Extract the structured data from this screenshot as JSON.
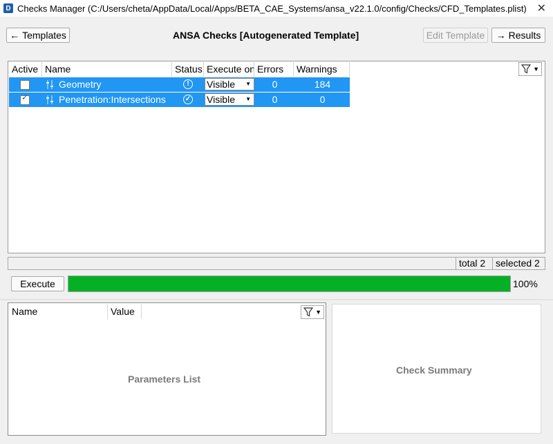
{
  "window": {
    "icon_letter": "D",
    "title": "Checks Manager (C:/Users/cheta/AppData/Local/Apps/BETA_CAE_Systems/ansa_v22.1.0/config/Checks/CFD_Templates.plist)",
    "close_glyph": "✕"
  },
  "toolbar": {
    "templates_label": "Templates",
    "templates_arrow": "←",
    "header_title": "ANSA Checks [Autogenerated Template]",
    "edit_template_label": "Edit Template",
    "results_label": "Results",
    "results_arrow": "→"
  },
  "checks_table": {
    "columns": [
      "Active",
      "Name",
      "Status",
      "Execute on",
      "Errors",
      "Warnings"
    ],
    "rows": [
      {
        "active": false,
        "name": "Geometry",
        "status_icon": "!",
        "execute_on": "Visible",
        "errors": "0",
        "warnings": "184"
      },
      {
        "active": true,
        "name": "Penetration:Intersections",
        "status_icon": "✓",
        "execute_on": "Visible",
        "errors": "0",
        "warnings": "0"
      }
    ],
    "row_color": "#2196f3"
  },
  "statusbar": {
    "total": "total 2",
    "selected": "selected 2"
  },
  "execute": {
    "button_label": "Execute",
    "progress_percent": 100,
    "progress_text": "100%",
    "progress_color": "#06b025"
  },
  "parameters": {
    "columns": [
      "Name",
      "Value"
    ],
    "placeholder": "Parameters List"
  },
  "summary": {
    "placeholder": "Check Summary"
  }
}
